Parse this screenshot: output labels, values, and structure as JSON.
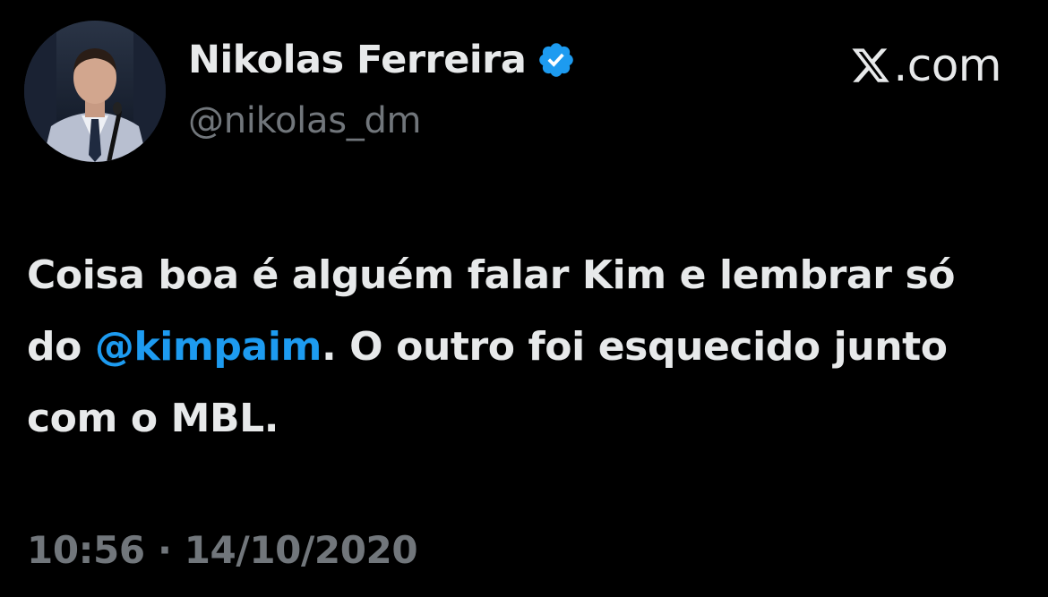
{
  "author": {
    "display_name": "Nikolas Ferreira",
    "handle": "@nikolas_dm",
    "verified": true
  },
  "brand": {
    "label": ".com",
    "icon": "x-logo-icon"
  },
  "tweet": {
    "text_before": "Coisa boa é alguém falar Kim e lembrar só do ",
    "mention": "@kimpaim",
    "text_after": ". O outro foi esquecido junto com o MBL."
  },
  "meta": {
    "time": "10:56",
    "separator": "·",
    "date": "14/10/2020"
  },
  "colors": {
    "background": "#000000",
    "text": "#e7e9ea",
    "muted": "#71767b",
    "accent": "#1d9bf0"
  }
}
